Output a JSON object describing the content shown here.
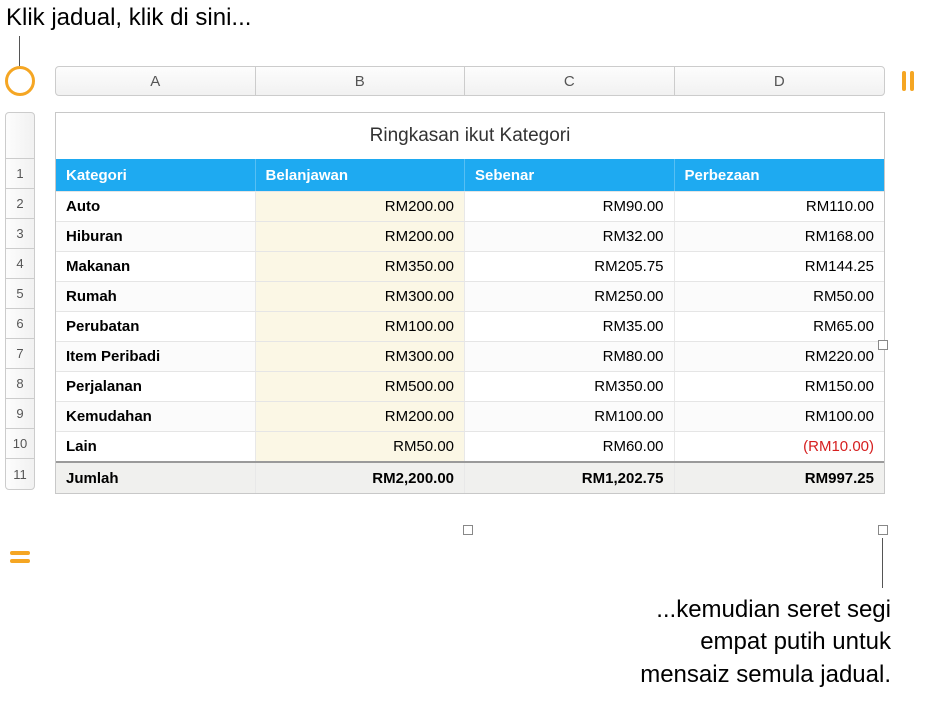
{
  "callouts": {
    "top": "Klik jadual, klik di sini...",
    "bottom_line1": "...kemudian seret segi",
    "bottom_line2": "empat putih untuk",
    "bottom_line3": "mensaiz semula jadual."
  },
  "columns": [
    "A",
    "B",
    "C",
    "D"
  ],
  "row_numbers": [
    "1",
    "2",
    "3",
    "4",
    "5",
    "6",
    "7",
    "8",
    "9",
    "10",
    "11"
  ],
  "table": {
    "title": "Ringkasan ikut Kategori",
    "headers": {
      "kategori": "Kategori",
      "belanjawan": "Belanjawan",
      "sebenar": "Sebenar",
      "perbezaan": "Perbezaan"
    },
    "rows": [
      {
        "kategori": "Auto",
        "belanjawan": "RM200.00",
        "sebenar": "RM90.00",
        "perbezaan": "RM110.00"
      },
      {
        "kategori": "Hiburan",
        "belanjawan": "RM200.00",
        "sebenar": "RM32.00",
        "perbezaan": "RM168.00"
      },
      {
        "kategori": "Makanan",
        "belanjawan": "RM350.00",
        "sebenar": "RM205.75",
        "perbezaan": "RM144.25"
      },
      {
        "kategori": "Rumah",
        "belanjawan": "RM300.00",
        "sebenar": "RM250.00",
        "perbezaan": "RM50.00"
      },
      {
        "kategori": "Perubatan",
        "belanjawan": "RM100.00",
        "sebenar": "RM35.00",
        "perbezaan": "RM65.00"
      },
      {
        "kategori": "Item Peribadi",
        "belanjawan": "RM300.00",
        "sebenar": "RM80.00",
        "perbezaan": "RM220.00"
      },
      {
        "kategori": "Perjalanan",
        "belanjawan": "RM500.00",
        "sebenar": "RM350.00",
        "perbezaan": "RM150.00"
      },
      {
        "kategori": "Kemudahan",
        "belanjawan": "RM200.00",
        "sebenar": "RM100.00",
        "perbezaan": "RM100.00"
      },
      {
        "kategori": "Lain",
        "belanjawan": "RM50.00",
        "sebenar": "RM60.00",
        "perbezaan": "(RM10.00)",
        "neg": true
      }
    ],
    "footer": {
      "label": "Jumlah",
      "belanjawan": "RM2,200.00",
      "sebenar": "RM1,202.75",
      "perbezaan": "RM997.25"
    }
  }
}
